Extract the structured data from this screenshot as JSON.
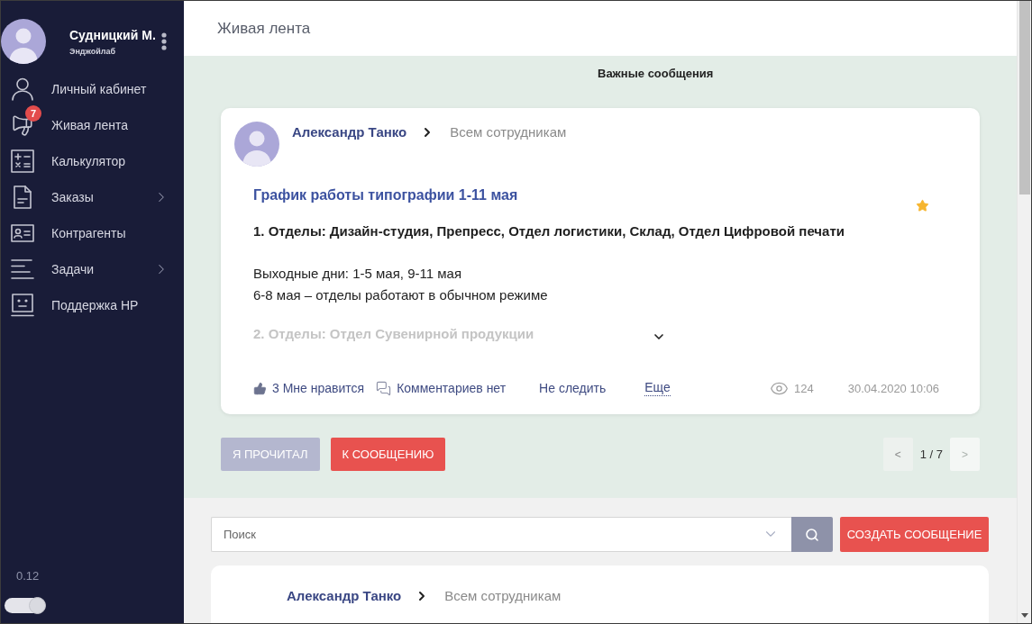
{
  "sidebar": {
    "user": {
      "name": "Судницкий М.",
      "company": "Энджойлаб"
    },
    "menu": [
      {
        "label": "Личный кабинет",
        "has_submenu": false
      },
      {
        "label": "Живая лента",
        "badge": "7",
        "has_submenu": false
      },
      {
        "label": "Калькулятор",
        "has_submenu": false
      },
      {
        "label": "Заказы",
        "has_submenu": true
      },
      {
        "label": "Контрагенты",
        "has_submenu": false
      },
      {
        "label": "Задачи",
        "has_submenu": true
      },
      {
        "label": "Поддержка HP",
        "has_submenu": false
      }
    ],
    "version": "0.12",
    "toggle": {
      "on": true
    }
  },
  "header": {
    "title": "Живая лента"
  },
  "important": {
    "title": "Важные сообщения",
    "post": {
      "author": "Александр Танко",
      "recipient": "Всем сотрудникам",
      "title": "График работы типографии 1-11 мая",
      "starred": true,
      "heading": "1. Отделы: Дизайн-студия, Препресс, Отдел логистики, Склад, Отдел Цифровой печати",
      "lines": [
        "Выходные дни: 1-5 мая, 9-11 мая",
        "6-8 мая – отделы работают в обычном режиме"
      ],
      "preview": "2. Отделы: Отдел Сувенирной продукции",
      "expanded": false,
      "likes": "3 Мне нравится",
      "comments": "Комментариев нет",
      "follow": "Не следить",
      "more": "Еще",
      "views": "124",
      "date": "30.04.2020 10:06"
    },
    "buttons": [
      {
        "label": "Я ПРОЧИТАЛ",
        "kind": "muted"
      },
      {
        "label": "К СООБЩЕНИЮ",
        "kind": "primary"
      }
    ],
    "pager": {
      "prev": {
        "label": "<",
        "disabled": false
      },
      "page": "1 / 7",
      "next": {
        "label": ">",
        "disabled": true
      }
    }
  },
  "feed": {
    "search": {
      "placeholder": "Поиск"
    },
    "create_button": "СОЗДАТЬ СООБЩЕНИЕ",
    "posts": [
      {
        "author": "Александр Танко",
        "recipient": "Всем сотрудникам"
      }
    ]
  }
}
